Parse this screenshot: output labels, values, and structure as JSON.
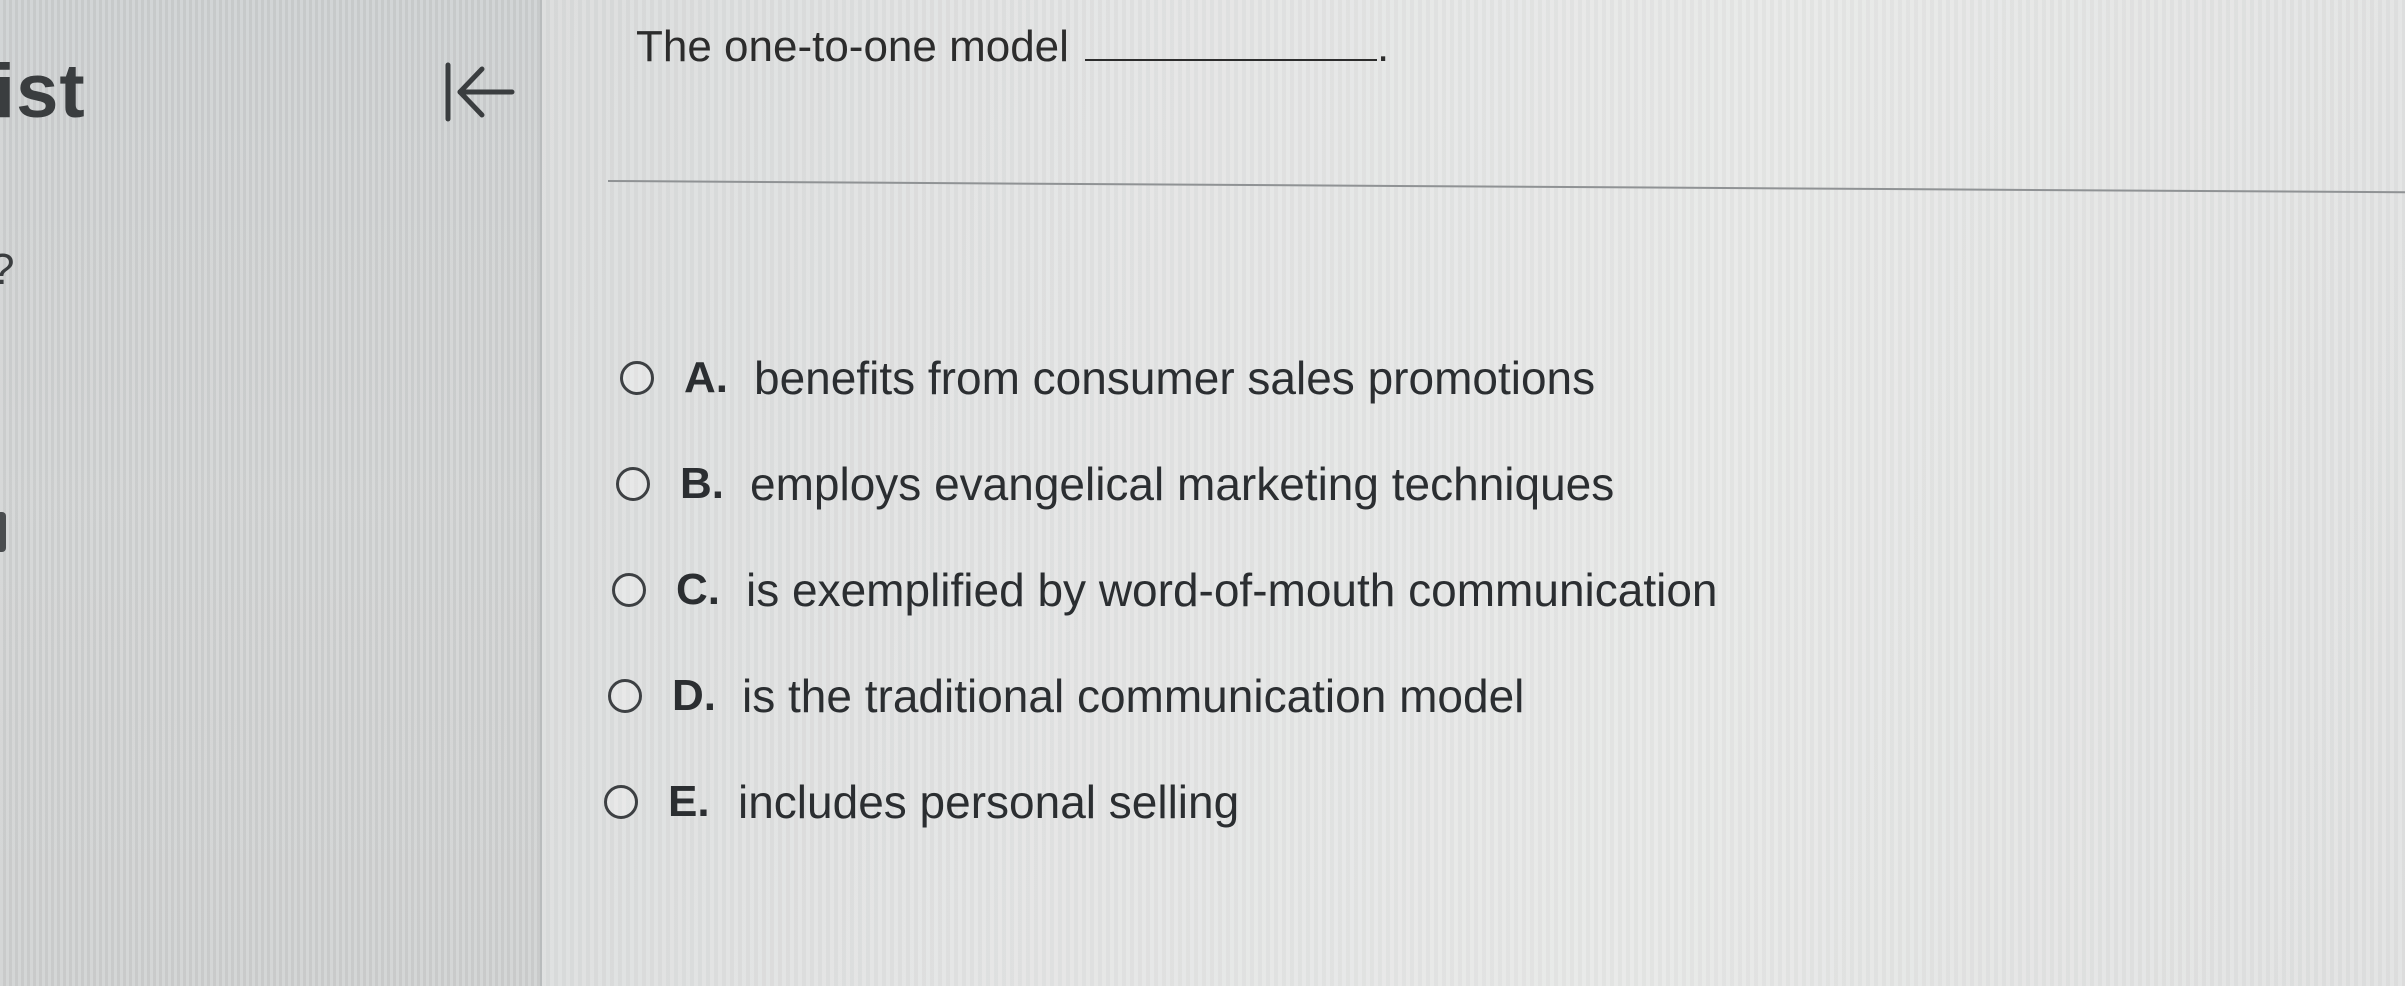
{
  "sidebar": {
    "title": "ist",
    "fragment": "?",
    "collapse_icon": "collapse-left-arrow-icon"
  },
  "question": {
    "text": "The one-to-one model",
    "end_punctuation": "."
  },
  "options": [
    {
      "letter": "A.",
      "text": "benefits from consumer sales promotions"
    },
    {
      "letter": "B.",
      "text": "employs evangelical marketing techniques"
    },
    {
      "letter": "C.",
      "text": "is exemplified by word-of-mouth communication"
    },
    {
      "letter": "D.",
      "text": "is the traditional communication model"
    },
    {
      "letter": "E.",
      "text": "includes personal selling"
    }
  ]
}
